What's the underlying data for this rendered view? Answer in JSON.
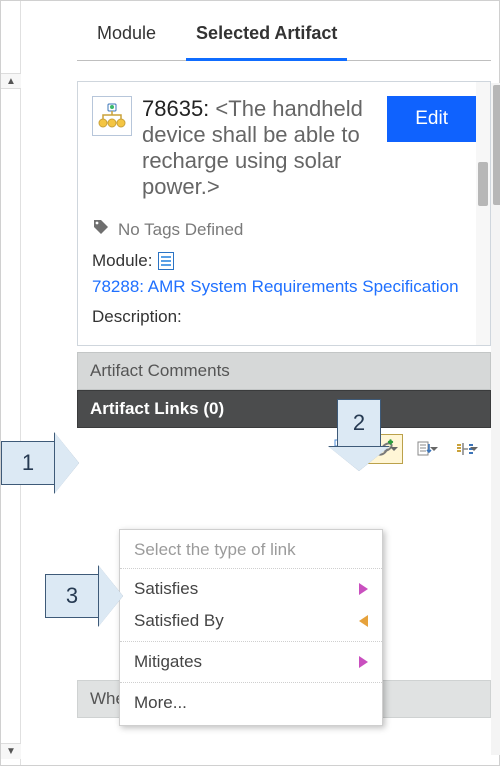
{
  "tabs": {
    "module": "Module",
    "selected": "Selected Artifact"
  },
  "artifact": {
    "id": "78635:",
    "text": "<The handheld device shall be able to recharge using solar power.>",
    "edit_label": "Edit",
    "tags_none": "No Tags Defined",
    "module_label": "Module:",
    "module_link": "78288: AMR System Requirements Specification",
    "description_label": "Description:"
  },
  "sections": {
    "comments": "Artifact Comments",
    "links": "Artifact Links (0)",
    "where": "Where Artifact Used"
  },
  "link_menu": {
    "header": "Select the type of link",
    "satisfies": "Satisfies",
    "satisfied_by": "Satisfied By",
    "mitigates": "Mitigates",
    "more": "More..."
  },
  "callouts": {
    "c1": "1",
    "c2": "2",
    "c3": "3"
  }
}
